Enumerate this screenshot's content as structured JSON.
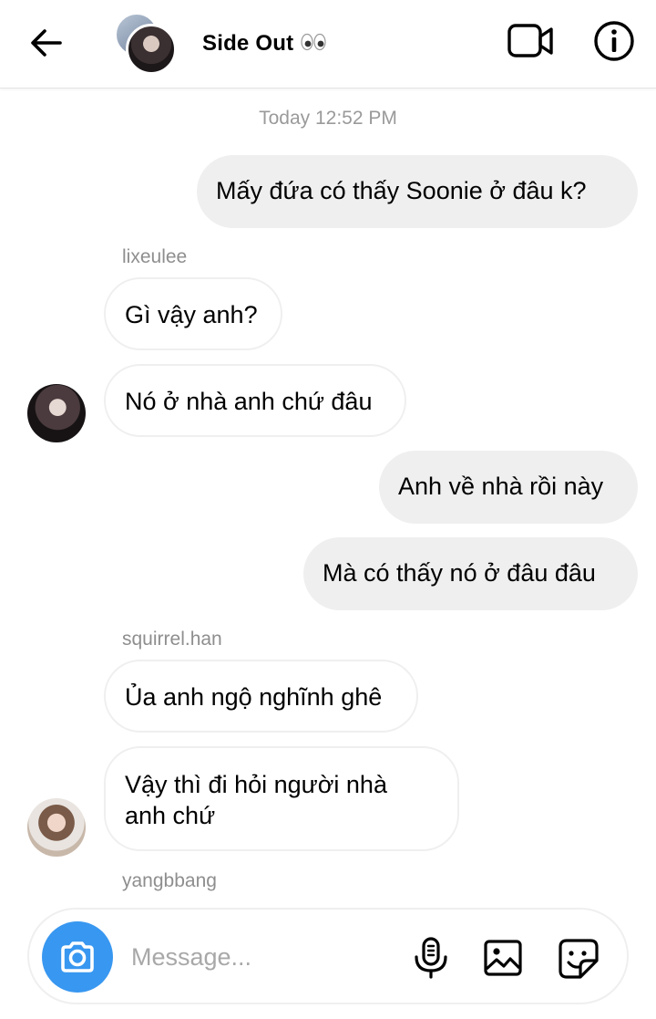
{
  "header": {
    "title": "Side Out",
    "icons": {
      "back": "arrow-left-icon",
      "video": "video-camera-icon",
      "info": "info-icon",
      "eyes": "eyes-emoji-icon"
    }
  },
  "conversation": {
    "timestamp": "Today 12:52 PM",
    "messages": [
      {
        "direction": "outgoing",
        "text": "Mấy đứa có thấy Soonie ở đâu k?"
      },
      {
        "direction": "incoming",
        "sender": "lixeulee",
        "text": "Gì vậy anh?"
      },
      {
        "direction": "incoming",
        "text": "Nó ở nhà anh chứ đâu"
      },
      {
        "direction": "outgoing",
        "text": "Anh về nhà rồi này"
      },
      {
        "direction": "outgoing",
        "text": "Mà có thấy nó ở đâu đâu"
      },
      {
        "direction": "incoming",
        "sender": "squirrel.han",
        "text": "Ủa anh ngộ nghĩnh ghê"
      },
      {
        "direction": "incoming",
        "text_line1": "Vậy thì đi hỏi người nhà",
        "text_line2": "anh chứ"
      }
    ],
    "typing_sender": "yangbbang"
  },
  "composer": {
    "placeholder": "Message...",
    "value": "",
    "icons": {
      "camera": "camera-icon",
      "mic": "microphone-icon",
      "gallery": "image-icon",
      "sticker": "sticker-icon"
    }
  },
  "colors": {
    "accent": "#3897f0",
    "bubble_outgoing": "#efefef",
    "bubble_incoming_border": "#efefef",
    "meta_text": "#8e8e8e"
  }
}
